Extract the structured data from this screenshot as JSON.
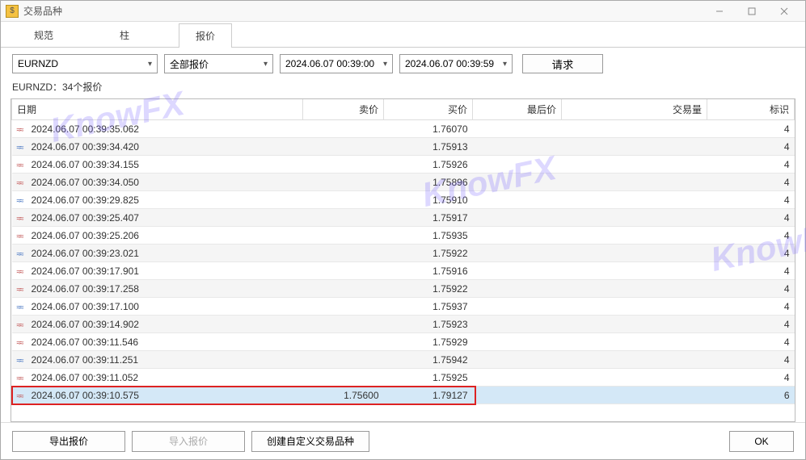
{
  "window": {
    "title": "交易品种"
  },
  "tabs": [
    {
      "label": "规范",
      "active": false
    },
    {
      "label": "柱",
      "active": false
    },
    {
      "label": "报价",
      "active": true
    }
  ],
  "filters": {
    "symbol": "EURNZD",
    "quote_type": "全部报价",
    "date_from": "2024.06.07 00:39:00",
    "date_to": "2024.06.07 00:39:59",
    "request_btn": "请求"
  },
  "info_label": "EURNZD：34个报价",
  "columns": {
    "date": "日期",
    "sell": "卖价",
    "buy": "买价",
    "last": "最后价",
    "volume": "交易量",
    "flag": "标识"
  },
  "rows": [
    {
      "date": "2024.06.07 00:39:35.062",
      "sell": "",
      "buy": "1.76070",
      "last": "",
      "vol": "",
      "flag": "4",
      "hl": false
    },
    {
      "date": "2024.06.07 00:39:34.420",
      "sell": "",
      "buy": "1.75913",
      "last": "",
      "vol": "",
      "flag": "4",
      "hl": false
    },
    {
      "date": "2024.06.07 00:39:34.155",
      "sell": "",
      "buy": "1.75926",
      "last": "",
      "vol": "",
      "flag": "4",
      "hl": false
    },
    {
      "date": "2024.06.07 00:39:34.050",
      "sell": "",
      "buy": "1.75896",
      "last": "",
      "vol": "",
      "flag": "4",
      "hl": false
    },
    {
      "date": "2024.06.07 00:39:29.825",
      "sell": "",
      "buy": "1.75910",
      "last": "",
      "vol": "",
      "flag": "4",
      "hl": false
    },
    {
      "date": "2024.06.07 00:39:25.407",
      "sell": "",
      "buy": "1.75917",
      "last": "",
      "vol": "",
      "flag": "4",
      "hl": false
    },
    {
      "date": "2024.06.07 00:39:25.206",
      "sell": "",
      "buy": "1.75935",
      "last": "",
      "vol": "",
      "flag": "4",
      "hl": false
    },
    {
      "date": "2024.06.07 00:39:23.021",
      "sell": "",
      "buy": "1.75922",
      "last": "",
      "vol": "",
      "flag": "4",
      "hl": false
    },
    {
      "date": "2024.06.07 00:39:17.901",
      "sell": "",
      "buy": "1.75916",
      "last": "",
      "vol": "",
      "flag": "4",
      "hl": false
    },
    {
      "date": "2024.06.07 00:39:17.258",
      "sell": "",
      "buy": "1.75922",
      "last": "",
      "vol": "",
      "flag": "4",
      "hl": false
    },
    {
      "date": "2024.06.07 00:39:17.100",
      "sell": "",
      "buy": "1.75937",
      "last": "",
      "vol": "",
      "flag": "4",
      "hl": false
    },
    {
      "date": "2024.06.07 00:39:14.902",
      "sell": "",
      "buy": "1.75923",
      "last": "",
      "vol": "",
      "flag": "4",
      "hl": false
    },
    {
      "date": "2024.06.07 00:39:11.546",
      "sell": "",
      "buy": "1.75929",
      "last": "",
      "vol": "",
      "flag": "4",
      "hl": false
    },
    {
      "date": "2024.06.07 00:39:11.251",
      "sell": "",
      "buy": "1.75942",
      "last": "",
      "vol": "",
      "flag": "4",
      "hl": false
    },
    {
      "date": "2024.06.07 00:39:11.052",
      "sell": "",
      "buy": "1.75925",
      "last": "",
      "vol": "",
      "flag": "4",
      "hl": false
    },
    {
      "date": "2024.06.07 00:39:10.575",
      "sell": "1.75600",
      "buy": "1.79127",
      "last": "",
      "vol": "",
      "flag": "6",
      "hl": true
    }
  ],
  "footer": {
    "export": "导出报价",
    "import": "导入报价",
    "create": "创建自定义交易品种",
    "ok": "OK"
  },
  "watermark": "KnowFX"
}
